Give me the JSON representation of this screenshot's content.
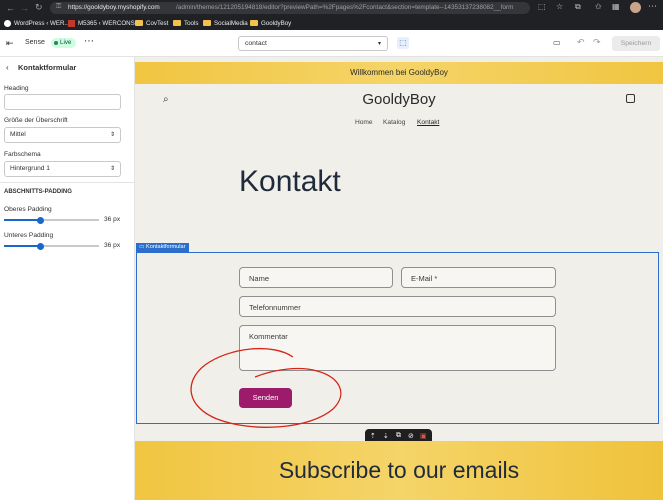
{
  "browser": {
    "url_host": "https://gooldyboy.myshopify.com",
    "url_path": "/admin/themes/121205194818/editor?previewPath=%2Fpages%2Fcontact&section=template--14353137238082__form",
    "bookmarks": [
      "WordPress ‹ WER...",
      "M5365 ‹ WERCONS",
      "CovTest",
      "Tools",
      "SocialMedia",
      "GooldyBoy"
    ]
  },
  "appbar": {
    "theme_name": "Sense",
    "live_badge": "Live",
    "page_select_value": "contact",
    "save_label": "Speichern"
  },
  "sidebar": {
    "title": "Kontaktformular",
    "heading_label": "Heading",
    "heading_value": "",
    "size_label": "Größe der Überschrift",
    "size_value": "Mittel",
    "scheme_label": "Farbschema",
    "scheme_value": "Hintergrund 1",
    "padding_header": "ABSCHNITTS-PADDING",
    "top_padding_label": "Oberes Padding",
    "top_padding_value": "36 px",
    "bottom_padding_label": "Unteres Padding",
    "bottom_padding_value": "36 px"
  },
  "store": {
    "announcement": "Willkommen bei GooldyBoy",
    "logo": "GooldyBoy",
    "nav": [
      "Home",
      "Katalog",
      "Kontakt"
    ],
    "page_heading": "Kontakt",
    "section_tag": "Kontaktformular",
    "form": {
      "name_placeholder": "Name",
      "email_placeholder": "E-Mail *",
      "phone_placeholder": "Telefonnummer",
      "comment_placeholder": "Kommentar",
      "submit_label": "Senden"
    },
    "newsletter_heading": "Subscribe to our emails"
  },
  "colors": {
    "accent_blue": "#2c6ecb",
    "banner_yellow": "#f0c541",
    "submit_purple": "#9c1c6b",
    "live_green": "#29845a",
    "annotation_red": "#d62418"
  }
}
